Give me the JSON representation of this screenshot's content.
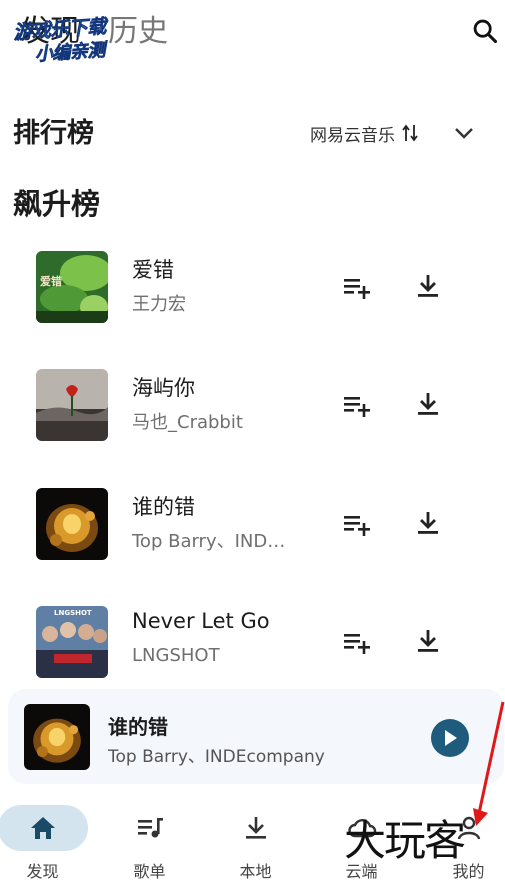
{
  "header": {
    "tabs": [
      {
        "label": "发现",
        "active": true
      },
      {
        "label": "历史",
        "active": false
      }
    ],
    "search_icon": "search-icon"
  },
  "watermark_top": {
    "line1": "游戏乐下载",
    "line2": "小编亲测"
  },
  "ranking": {
    "title": "排行榜",
    "source": "网易云音乐",
    "sort_icon": "swap-vert-icon",
    "expand_icon": "chevron-down-icon"
  },
  "chart": {
    "title": "飙升榜",
    "songs": [
      {
        "title": "爱错",
        "artist": "王力宏",
        "cover_text": "爱错"
      },
      {
        "title": "海屿你",
        "artist": "马也_Crabbit"
      },
      {
        "title": "谁的错",
        "artist": "Top Barry、IND…"
      },
      {
        "title": "Never Let Go",
        "artist": "LNGSHOT",
        "cover_text": "LNGSHOT"
      }
    ],
    "add_icon": "playlist-add-icon",
    "download_icon": "download-icon"
  },
  "player": {
    "title": "谁的错",
    "artist": "Top Barry、INDEcompany",
    "play_icon": "play-icon"
  },
  "nav": {
    "items": [
      {
        "label": "发现",
        "icon": "home-icon",
        "active": true
      },
      {
        "label": "歌单",
        "icon": "playlist-icon",
        "active": false
      },
      {
        "label": "本地",
        "icon": "download-icon",
        "active": false
      },
      {
        "label": "云端",
        "icon": "cloud-icon",
        "active": false
      },
      {
        "label": "我的",
        "icon": "person-icon",
        "active": false
      }
    ]
  },
  "watermark_bottom": "大玩客",
  "colors": {
    "accent": "#1e5b7c",
    "nav_active_bg": "#d3e4ef",
    "player_bg": "#f4f7fb",
    "watermark_arrow": "#e01818"
  }
}
